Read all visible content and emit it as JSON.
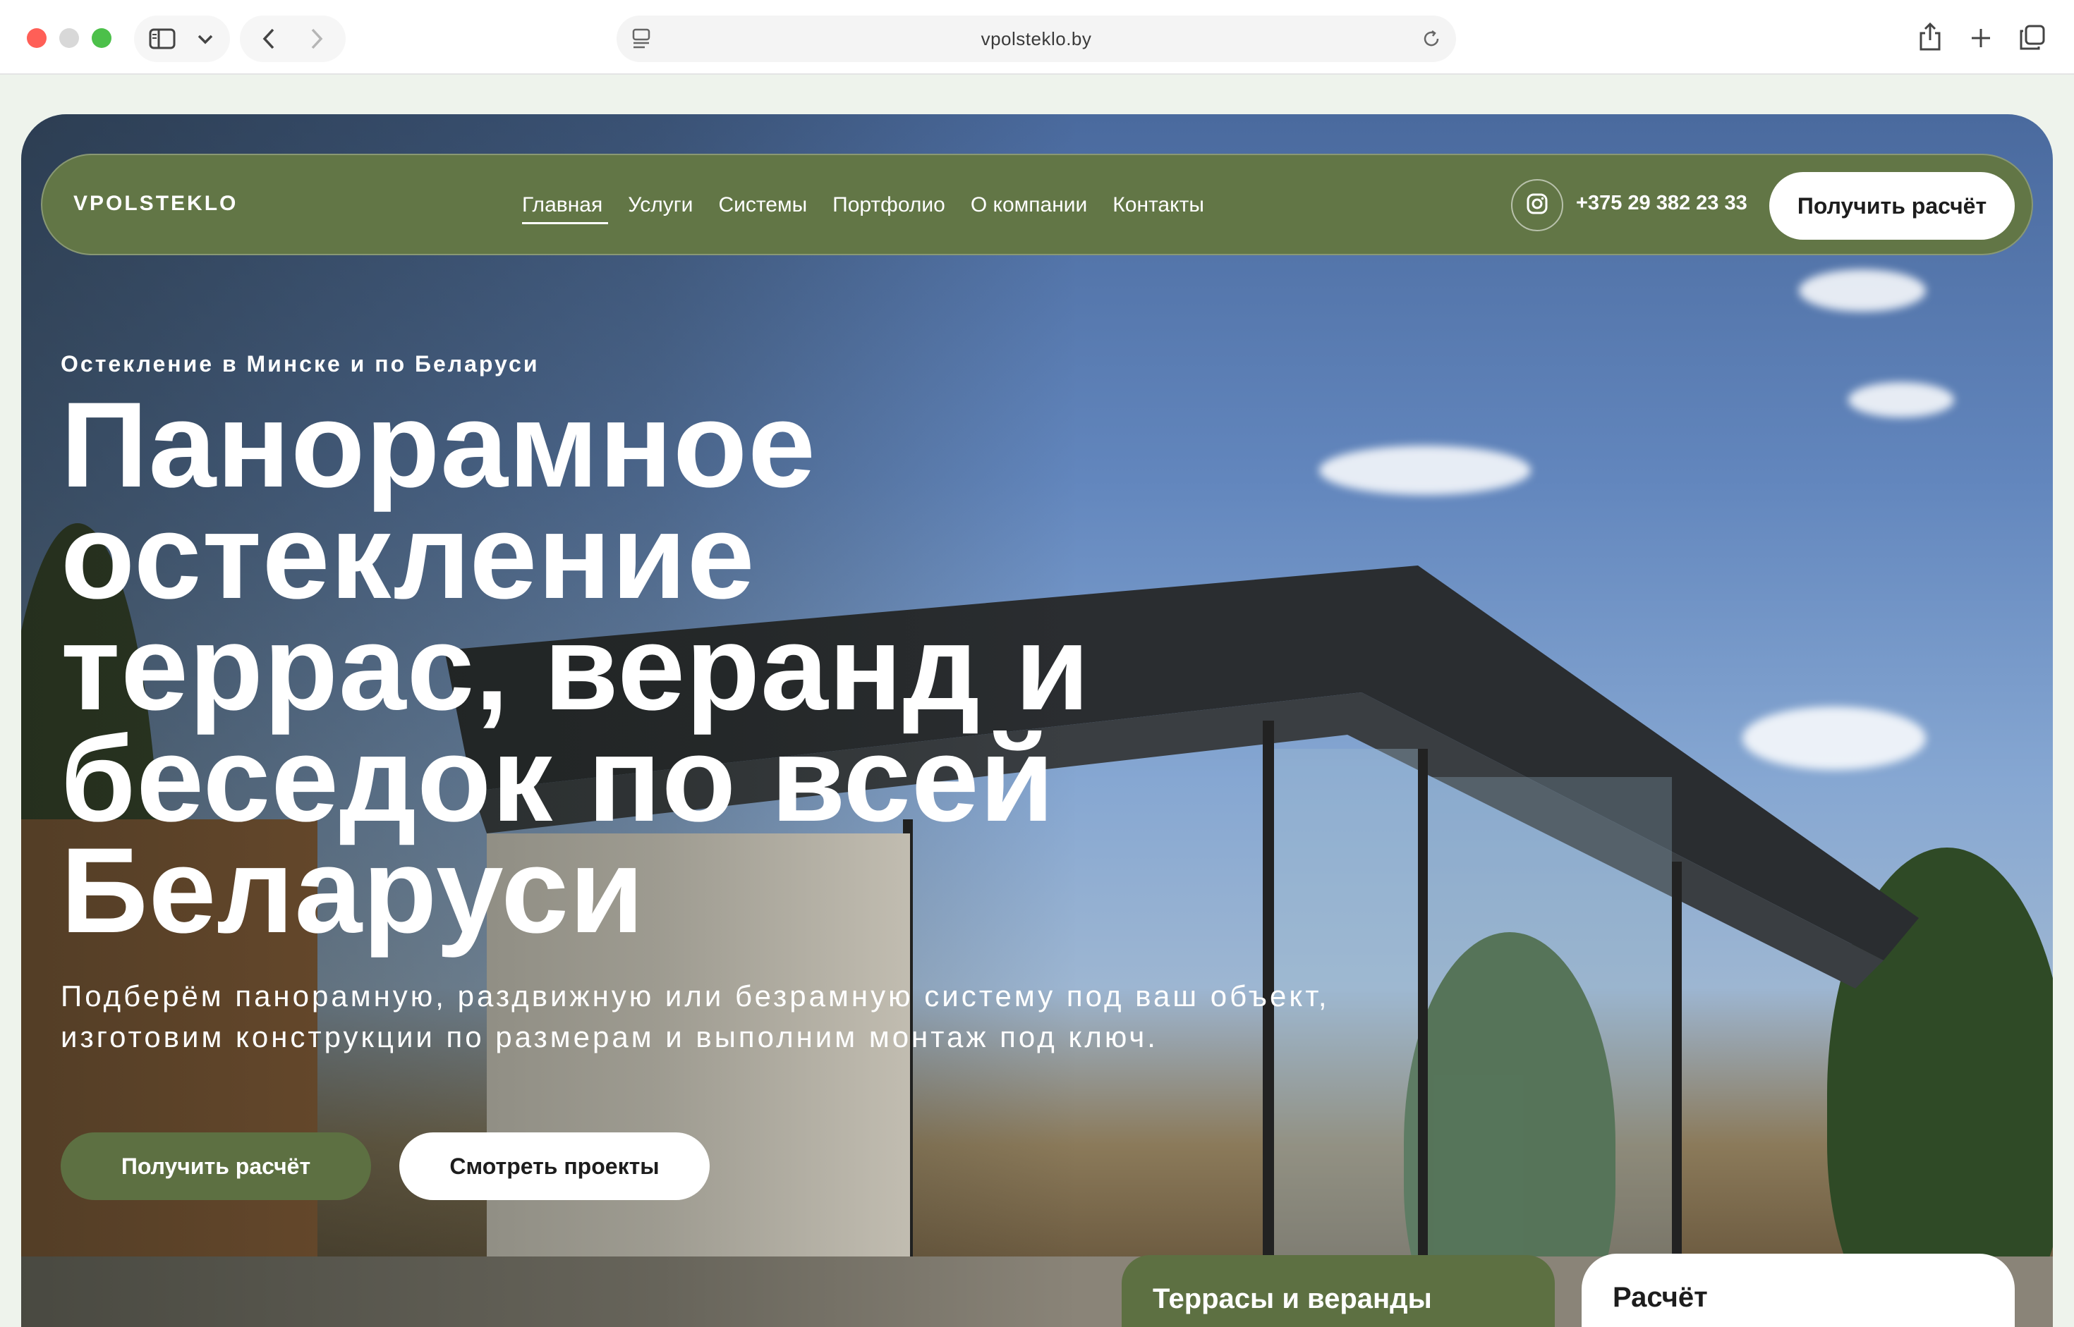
{
  "browser": {
    "url": "vpolsteklo.by"
  },
  "nav": {
    "brand": "VPOLSTEKLO",
    "items": [
      {
        "label": "Главная",
        "active": true
      },
      {
        "label": "Услуги"
      },
      {
        "label": "Системы"
      },
      {
        "label": "Портфолио"
      },
      {
        "label": "О компании"
      },
      {
        "label": "Контакты"
      }
    ],
    "phone": "+375 29 382 23 33",
    "cta_label": "Получить расчёт"
  },
  "hero": {
    "eyebrow": "Остекление в Минске и по Беларуси",
    "headline": "Панорамное остекление террас, веранд и беседок по всей Беларуси",
    "lead": "Подберём панорамную, раздвижную или безрамную систему под ваш объект, изготовим конструкции по размерам и выполним монтаж под ключ.",
    "primary_button": "Получить расчёт",
    "secondary_button": "Смотреть проекты"
  },
  "cards": {
    "left_title": "Террасы и веранды",
    "right_title": "Расчёт"
  },
  "colors": {
    "accent_green": "#627646",
    "button_green": "#5d7042"
  }
}
